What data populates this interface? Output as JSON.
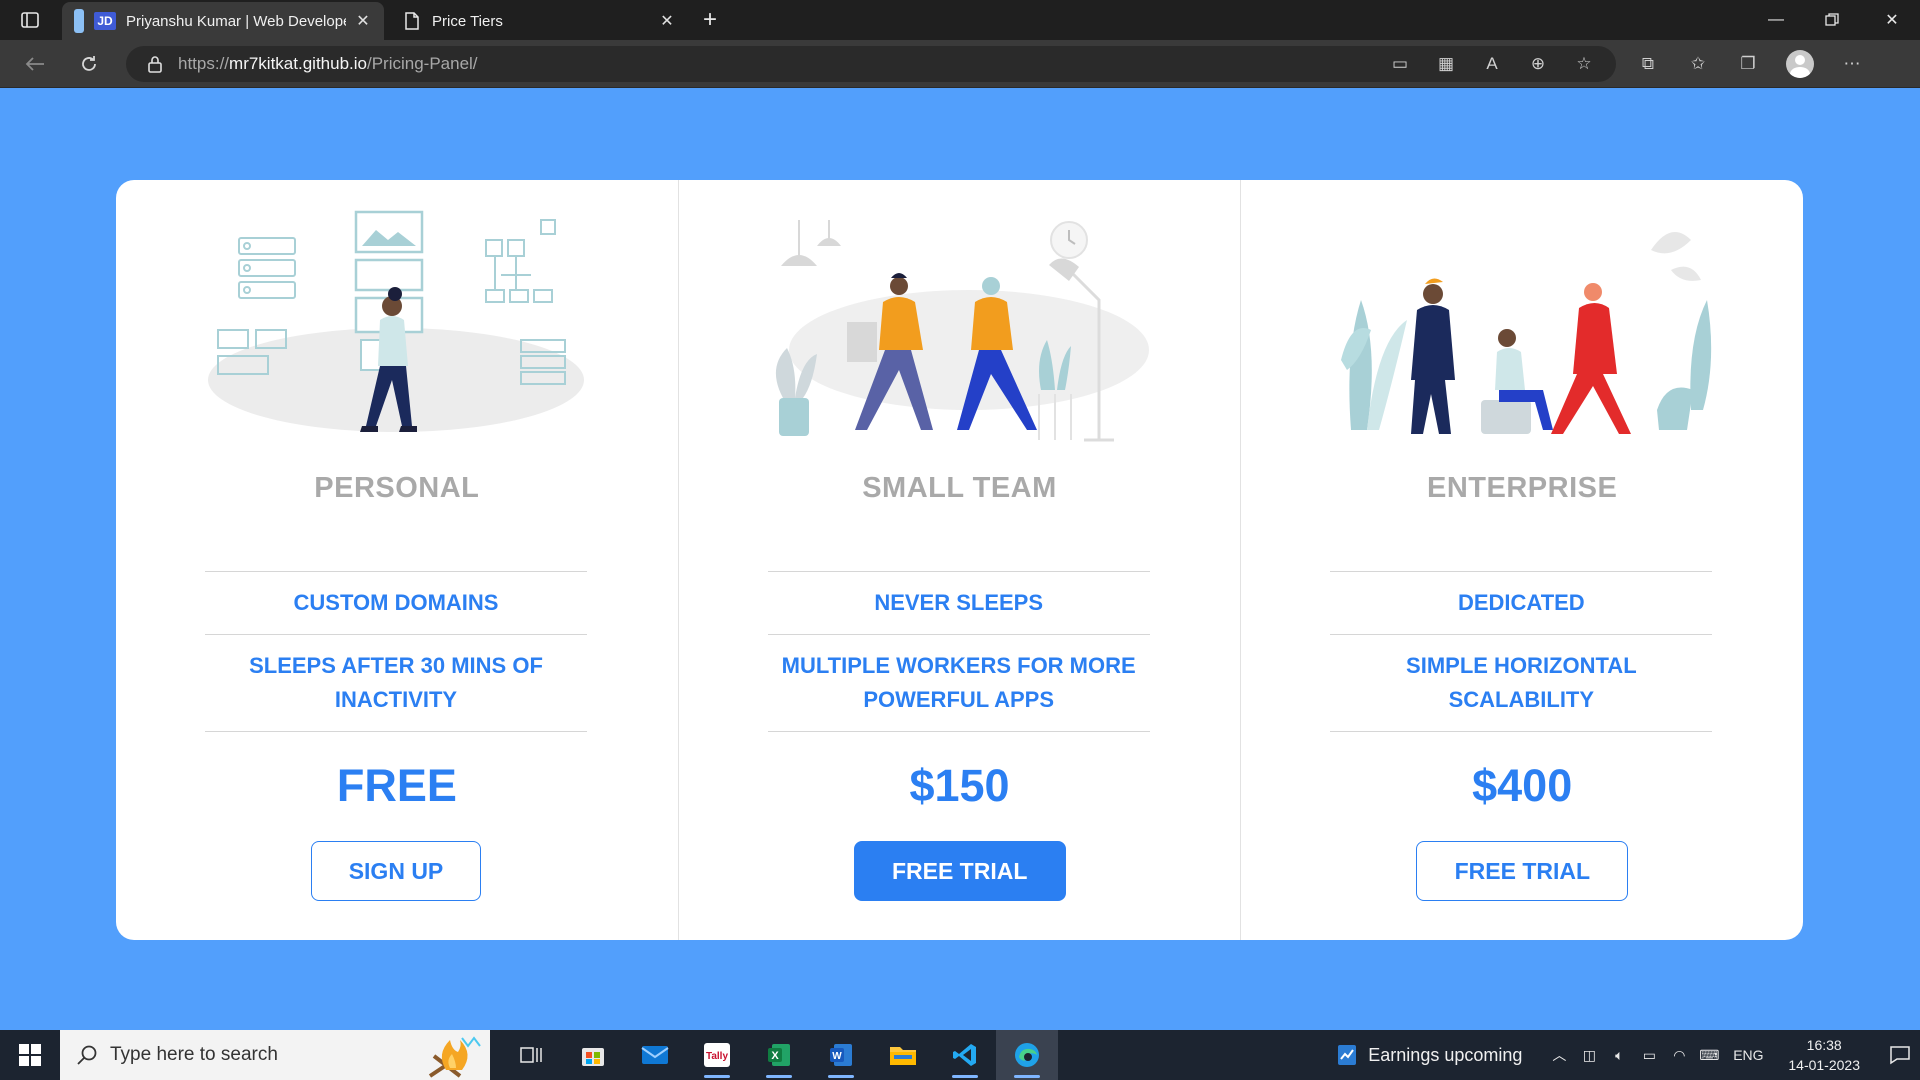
{
  "browser": {
    "tabs": [
      {
        "title": "Priyanshu Kumar | Web Develope",
        "favicon": "JD",
        "active": true
      },
      {
        "title": "Price Tiers",
        "active": false
      }
    ],
    "url": {
      "scheme": "https://",
      "host": "mr7kitkat.github.io",
      "path": "/Pricing-Panel/"
    }
  },
  "page": {
    "background": "#529ffc",
    "accent": "#2b7ff2",
    "tiers": [
      {
        "name": "PERSONAL",
        "features": [
          "CUSTOM DOMAINS",
          "SLEEPS AFTER 30 MINS OF INACTIVITY"
        ],
        "price": "FREE",
        "cta": "SIGN UP",
        "cta_style": "outline",
        "illustration": "person-with-whiteboards"
      },
      {
        "name": "SMALL TEAM",
        "features": [
          "NEVER SLEEPS",
          "MULTIPLE WORKERS FOR MORE POWERFUL APPS"
        ],
        "price": "$150",
        "cta": "FREE TRIAL",
        "cta_style": "filled",
        "illustration": "two-people-walking"
      },
      {
        "name": "ENTERPRISE",
        "features": [
          "DEDICATED",
          "SIMPLE HORIZONTAL SCALABILITY"
        ],
        "price": "$400",
        "cta": "FREE TRIAL",
        "cta_style": "outline",
        "illustration": "team-meeting-with-plants"
      }
    ]
  },
  "taskbar": {
    "search_placeholder": "Type here to search",
    "news": "Earnings upcoming",
    "language": "ENG",
    "time": "16:38",
    "date": "14-01-2023",
    "apps": [
      "task-view",
      "microsoft-store",
      "mail",
      "tally",
      "excel",
      "word",
      "file-explorer",
      "vscode",
      "edge"
    ]
  }
}
